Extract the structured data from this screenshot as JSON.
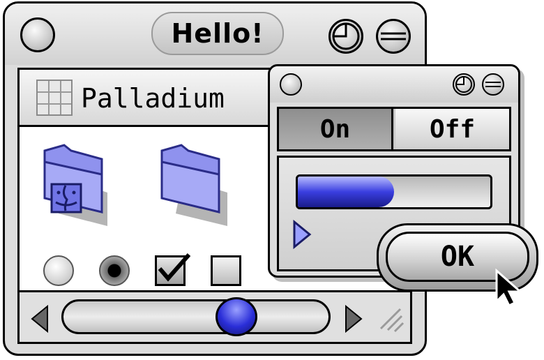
{
  "main_window": {
    "title": "Hello!",
    "path_label": "Palladium"
  },
  "controls_window": {
    "segments": [
      {
        "label": "On",
        "selected": true
      },
      {
        "label": "Off",
        "selected": false
      }
    ],
    "progress": 0.5
  },
  "ok_button": {
    "label": "OK"
  },
  "icons": [
    "close-box-icon",
    "collapse-box-icon",
    "zoom-box-icon",
    "grid-view-icon",
    "system-folder-icon",
    "folder-icon",
    "scroll-left-arrow-icon",
    "scroll-right-arrow-icon",
    "resize-grip-icon",
    "disclosure-triangle-icon",
    "mouse-pointer-icon"
  ],
  "colors": {
    "accent": "#2a2ed8",
    "window_bg": "#dcdcdc"
  },
  "states": {
    "radio_unselected": false,
    "radio_selected": true,
    "checkbox_checked": true,
    "checkbox_unchecked": false
  }
}
